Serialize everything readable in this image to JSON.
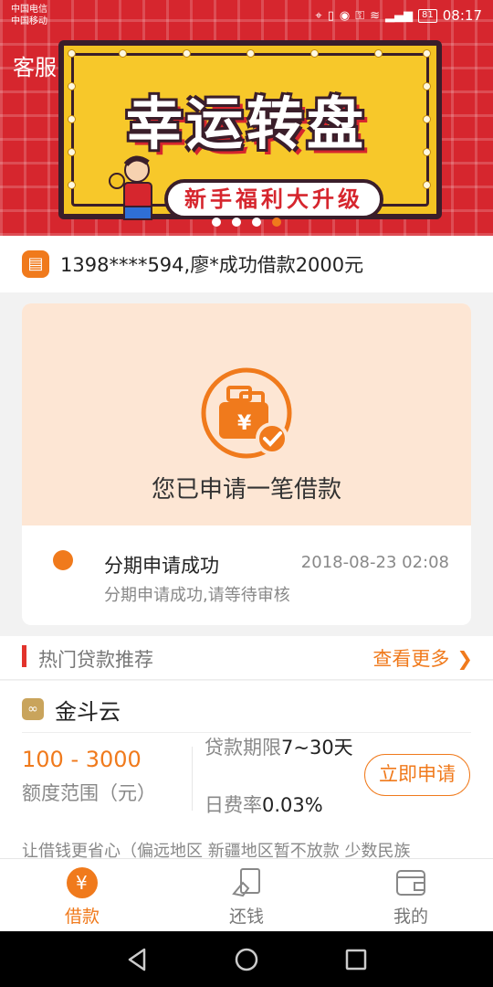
{
  "status_bar": {
    "carrier1": "中国电信",
    "carrier2": "中国移动",
    "battery": "81",
    "time": "08:17"
  },
  "banner": {
    "kefu_label": "客服",
    "title": "幸运转盘",
    "subtitle": "新手福利大升级",
    "slide_count": 4,
    "active_slide": 4
  },
  "notice": {
    "text": "1398****594,廖*成功借款2000元"
  },
  "application": {
    "status_text": "您已申请一笔借款",
    "record": {
      "title": "分期申请成功",
      "time": "2018-08-23 02:08",
      "subtitle": "分期申请成功,请等待审核"
    }
  },
  "hot": {
    "title": "热门贷款推荐",
    "more_label": "查看更多"
  },
  "loan": {
    "name": "金斗云",
    "amount": "100 - 3000",
    "amount_label": "额度范围（元）",
    "term_label": "贷款期限",
    "term_value": "7~30天",
    "rate_label": "日费率",
    "rate_value": "0.03%",
    "apply_label": "立即申请",
    "description": "让借钱更省心（偏远地区 新疆地区暂不放款 少数民族"
  },
  "tabs": [
    {
      "label": "借款",
      "icon": "yuan-icon",
      "active": true
    },
    {
      "label": "还钱",
      "icon": "repay-icon",
      "active": false
    },
    {
      "label": "我的",
      "icon": "wallet-icon",
      "active": false
    }
  ],
  "colors": {
    "accent": "#f07a1c",
    "banner_red": "#d6262e",
    "card_bg": "#fde6d4"
  }
}
